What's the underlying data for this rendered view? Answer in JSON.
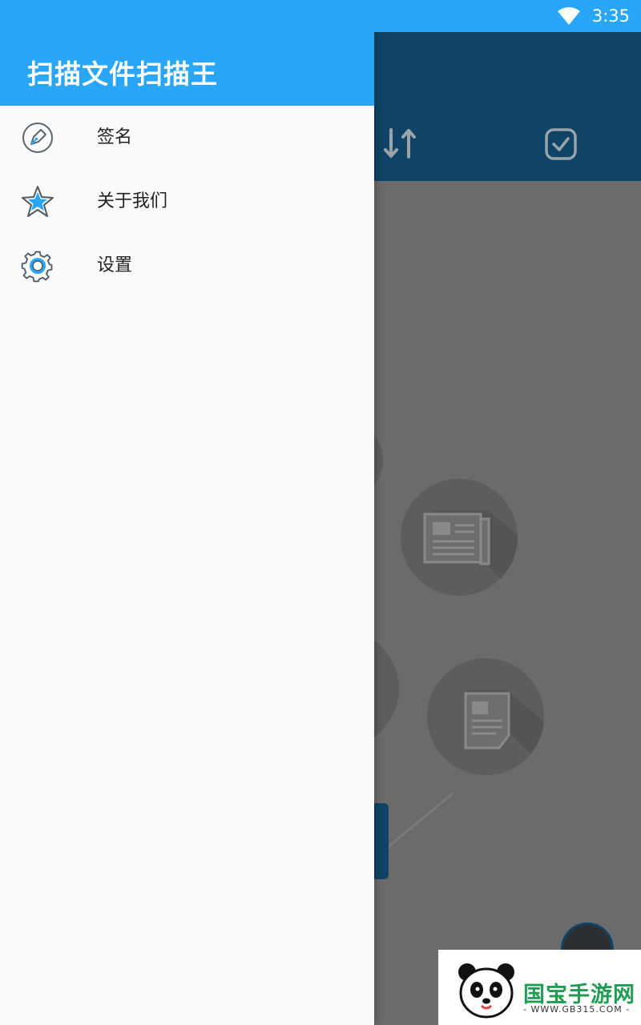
{
  "status_bar": {
    "time": "3:35",
    "wifi_icon": "wifi-icon"
  },
  "app": {
    "title": "扫描文件扫描王",
    "toolbar_icons": [
      "sort-icon",
      "select-all-icon"
    ]
  },
  "drawer": {
    "items": [
      {
        "label": "签名",
        "icon": "pen-icon"
      },
      {
        "label": "关于我们",
        "icon": "star-icon"
      },
      {
        "label": "设置",
        "icon": "gear-icon"
      }
    ]
  },
  "watermark": {
    "brand": "国宝手游网",
    "url": "- WWW.GB315.COM -"
  },
  "colors": {
    "primary": "#2aa6f9",
    "toolbar_dark": "#0f4466",
    "scrim": "#6b6b6b",
    "drawer_bg": "#fafafa"
  }
}
